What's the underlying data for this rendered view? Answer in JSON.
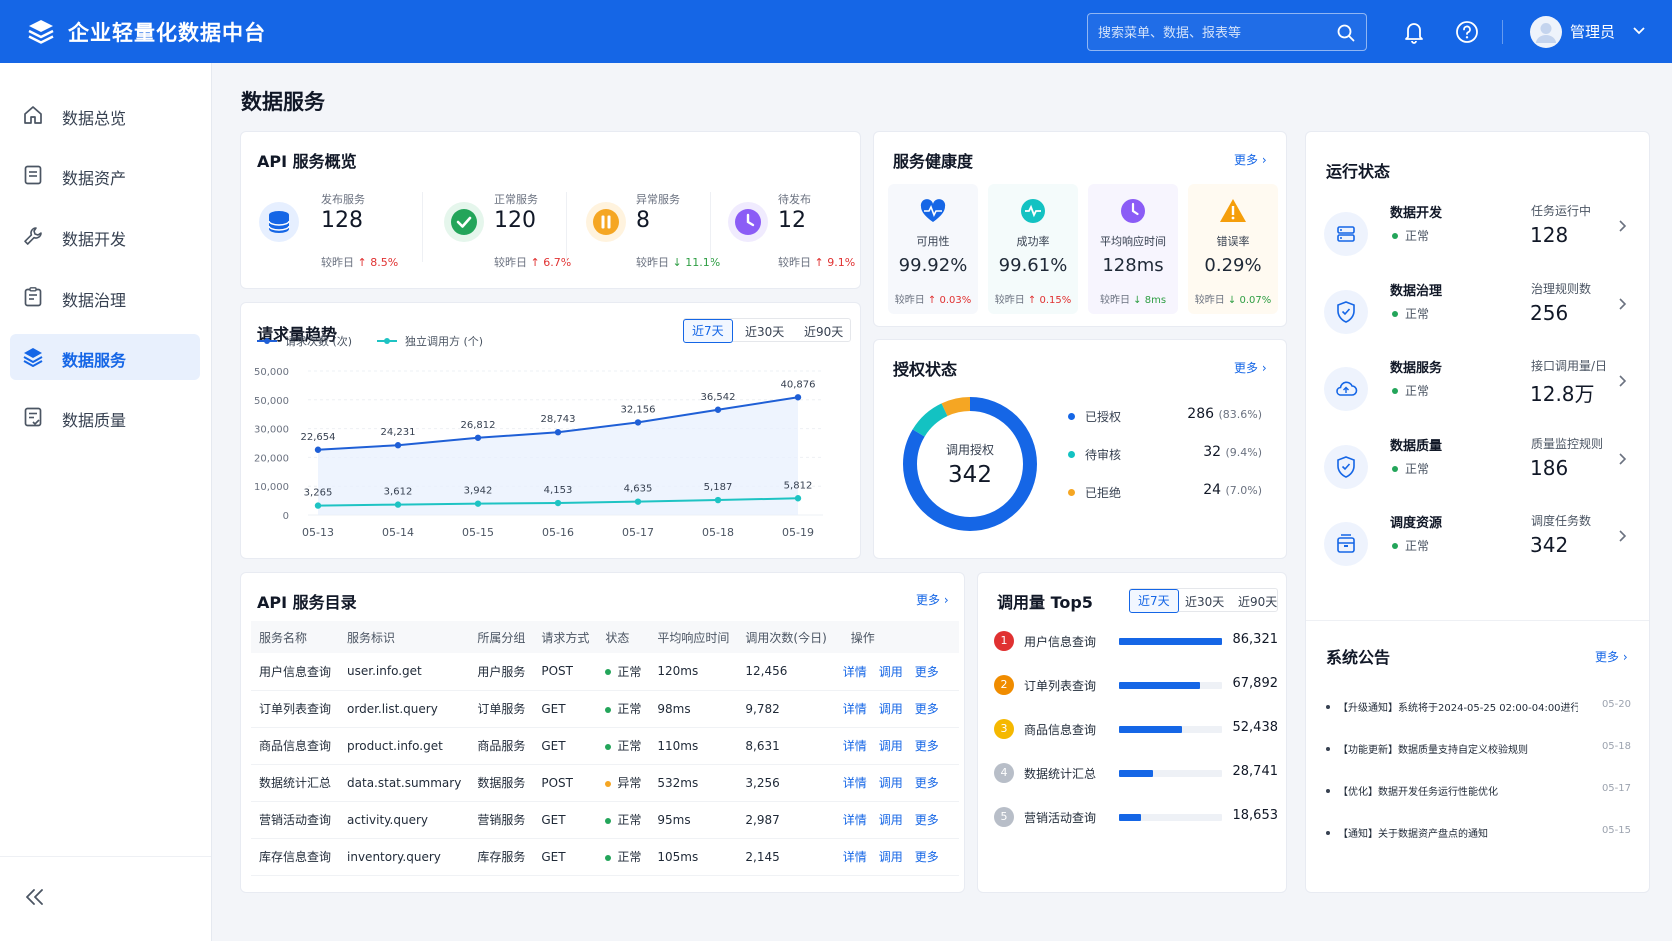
{
  "app": {
    "title": "企业轻量化数据中台"
  },
  "header": {
    "search_placeholder": "搜索菜单、数据、报表等",
    "user_name": "管理员"
  },
  "sidebar": {
    "items": [
      {
        "label": "数据总览",
        "icon": "home-icon"
      },
      {
        "label": "数据资产",
        "icon": "document-icon"
      },
      {
        "label": "数据开发",
        "icon": "wrench-icon"
      },
      {
        "label": "数据治理",
        "icon": "clipboard-icon"
      },
      {
        "label": "数据服务",
        "icon": "layers-icon",
        "active": true
      },
      {
        "label": "数据质量",
        "icon": "checklist-icon"
      }
    ]
  },
  "page": {
    "title": "数据服务"
  },
  "overview": {
    "title": "API 服务概览",
    "stats": [
      {
        "label": "发布服务",
        "value": "128",
        "compare": "较昨日",
        "delta": "8.5%",
        "trend": "up",
        "color": "#1566e6",
        "icon": "database-icon"
      },
      {
        "label": "正常服务",
        "value": "120",
        "compare": "较昨日",
        "delta": "6.7%",
        "trend": "up",
        "color": "#23a55a",
        "icon": "check-icon"
      },
      {
        "label": "异常服务",
        "value": "8",
        "compare": "较昨日",
        "delta": "11.1%",
        "trend": "down",
        "color": "#f5a623",
        "icon": "pause-icon"
      },
      {
        "label": "待发布",
        "value": "12",
        "compare": "较昨日",
        "delta": "9.1%",
        "trend": "up",
        "color": "#8b5cf6",
        "icon": "clock-icon"
      }
    ]
  },
  "health": {
    "title": "服务健康度",
    "more": "更多",
    "items": [
      {
        "label": "可用性",
        "value": "99.92%",
        "compare": "较昨日",
        "delta": "0.03%",
        "trend": "up",
        "color": "#1566e6",
        "icon": "heartbeat-icon"
      },
      {
        "label": "成功率",
        "value": "99.61%",
        "compare": "较昨日",
        "delta": "0.15%",
        "trend": "up",
        "color": "#13c2c2",
        "icon": "pulse-icon"
      },
      {
        "label": "平均响应时间",
        "value": "128ms",
        "compare": "较昨日",
        "delta": "8ms",
        "trend": "down",
        "color": "#8b5cf6",
        "icon": "clock-icon"
      },
      {
        "label": "错误率",
        "value": "0.29%",
        "compare": "较昨日",
        "delta": "0.07%",
        "trend": "down",
        "color": "#f59e0b",
        "icon": "warning-icon"
      }
    ]
  },
  "trend": {
    "title": "请求量趋势",
    "tabs": [
      "近7天",
      "近30天",
      "近90天"
    ],
    "chart_data": {
      "type": "line",
      "categories": [
        "05-13",
        "05-14",
        "05-15",
        "05-16",
        "05-17",
        "05-18",
        "05-19"
      ],
      "series": [
        {
          "name": "请求次数 (次)",
          "values": [
            22654,
            24231,
            26812,
            28743,
            32156,
            36542,
            40876
          ],
          "color": "#1f5fd6"
        },
        {
          "name": "独立调用方 (个)",
          "values": [
            3265,
            3612,
            3942,
            4153,
            4635,
            5187,
            5812
          ],
          "color": "#1ec3c3"
        }
      ],
      "ytick_labels": [
        "0",
        "10,000",
        "20,000",
        "30,000",
        "50,000",
        "50,000"
      ],
      "y_ticks": [
        0,
        10000,
        20000,
        30000,
        40000,
        50000
      ],
      "ylim": [
        0,
        50000
      ],
      "grid": true,
      "legend": "top-left"
    }
  },
  "auth": {
    "title": "授权状态",
    "more": "更多",
    "center_label": "调用授权",
    "center_value": "342",
    "chart_data": {
      "type": "pie",
      "labels": [
        "已授权",
        "待审核",
        "已拒绝"
      ],
      "values": [
        286,
        32,
        24
      ],
      "percents": [
        "(83.6%)",
        "(9.4%)",
        "(7.0%)"
      ],
      "colors": [
        "#1566e6",
        "#13c2c2",
        "#f5a623"
      ]
    }
  },
  "catalog": {
    "title": "API 服务目录",
    "more": "更多",
    "columns": [
      "服务名称",
      "服务标识",
      "所属分组",
      "请求方式",
      "状态",
      "平均响应时间",
      "调用次数(今日)",
      "操作"
    ],
    "rows": [
      {
        "name": "用户信息查询",
        "id": "user.info.get",
        "group": "用户服务",
        "method": "POST",
        "status": "正常",
        "ok": true,
        "resp": "120ms",
        "calls": "12,456"
      },
      {
        "name": "订单列表查询",
        "id": "order.list.query",
        "group": "订单服务",
        "method": "GET",
        "status": "正常",
        "ok": true,
        "resp": "98ms",
        "calls": "9,782"
      },
      {
        "name": "商品信息查询",
        "id": "product.info.get",
        "group": "商品服务",
        "method": "GET",
        "status": "正常",
        "ok": true,
        "resp": "110ms",
        "calls": "8,631"
      },
      {
        "name": "数据统计汇总",
        "id": "data.stat.summary",
        "group": "数据服务",
        "method": "POST",
        "status": "异常",
        "ok": false,
        "resp": "532ms",
        "calls": "3,256"
      },
      {
        "name": "营销活动查询",
        "id": "activity.query",
        "group": "营销服务",
        "method": "GET",
        "status": "正常",
        "ok": true,
        "resp": "95ms",
        "calls": "2,987"
      },
      {
        "name": "库存信息查询",
        "id": "inventory.query",
        "group": "库存服务",
        "method": "GET",
        "status": "正常",
        "ok": true,
        "resp": "105ms",
        "calls": "2,145"
      }
    ],
    "ops": [
      "详情",
      "调用",
      "更多"
    ]
  },
  "top5": {
    "title": "调用量 Top5",
    "tabs": [
      "近7天",
      "近30天",
      "近90天"
    ],
    "chart_data": {
      "type": "bar",
      "categories": [
        "用户信息查询",
        "订单列表查询",
        "商品信息查询",
        "数据统计汇总",
        "营销活动查询"
      ],
      "values": [
        86321,
        67892,
        52438,
        28741,
        18653
      ],
      "value_labels": [
        "86,321",
        "67,892",
        "52,438",
        "28,741",
        "18,653"
      ],
      "ranks": [
        "1",
        "2",
        "3",
        "4",
        "5"
      ],
      "rank_colors": [
        "#e03131",
        "#f08c00",
        "#f5b800",
        "#b8bec8",
        "#b8bec8"
      ]
    }
  },
  "runtime": {
    "title": "运行状态",
    "items": [
      {
        "name": "数据开发",
        "status": "正常",
        "metric_label": "任务运行中",
        "metric_value": "128",
        "icon": "server-icon"
      },
      {
        "name": "数据治理",
        "status": "正常",
        "metric_label": "治理规则数",
        "metric_value": "256",
        "icon": "shield-icon"
      },
      {
        "name": "数据服务",
        "status": "正常",
        "metric_label": "接口调用量/日",
        "metric_value": "12.8万",
        "icon": "cloud-icon"
      },
      {
        "name": "数据质量",
        "status": "正常",
        "metric_label": "质量监控规则",
        "metric_value": "186",
        "icon": "shield-check-icon"
      },
      {
        "name": "调度资源",
        "status": "正常",
        "metric_label": "调度任务数",
        "metric_value": "342",
        "icon": "box-icon"
      }
    ]
  },
  "notices": {
    "title": "系统公告",
    "more": "更多",
    "items": [
      {
        "text": "【升级通知】系统将于2024-05-25 02:00-04:00进行...",
        "date": "05-20"
      },
      {
        "text": "【功能更新】数据质量支持自定义校验规则",
        "date": "05-18"
      },
      {
        "text": "【优化】数据开发任务运行性能优化",
        "date": "05-17"
      },
      {
        "text": "【通知】关于数据资产盘点的通知",
        "date": "05-15"
      }
    ]
  }
}
